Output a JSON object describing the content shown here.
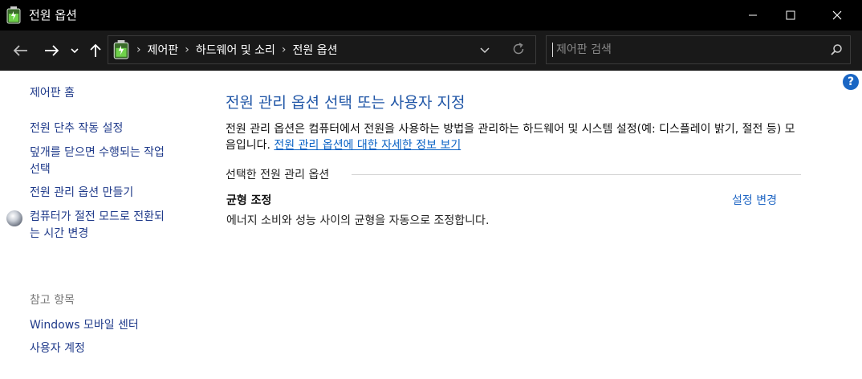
{
  "window": {
    "title": "전원 옵션"
  },
  "address": {
    "crumbs": [
      "제어판",
      "하드웨어 및 소리",
      "전원 옵션"
    ]
  },
  "search": {
    "placeholder": "제어판 검색"
  },
  "sidebar": {
    "home": "제어판 홈",
    "tasks": [
      "전원 단추 작동 설정",
      "덮개를 닫으면 수행되는 작업",
      "선택",
      "전원 관리 옵션 만들기",
      "컴퓨터가 절전 모드로 전환되",
      "는 시간 변경"
    ],
    "see_also_heading": "참고 항목",
    "see_also": [
      "Windows 모바일 센터",
      "사용자 계정"
    ]
  },
  "main": {
    "heading": "전원 관리 옵션 선택 또는 사용자 지정",
    "description": "전원 관리 옵션은 컴퓨터에서 전원을 사용하는 방법을 관리하는 하드웨어 및 시스템 설정(예: 디스플레이 밝기, 절전 등) 모음입니다. ",
    "description_link": "전원 관리 옵션에 대한 자세한 정보 보기",
    "section_title": "선택한 전원 관리 옵션",
    "plan": {
      "name": "균형 조정",
      "description": "에너지 소비와 성능 사이의 균형을 자동으로 조정합니다.",
      "change_link": "설정 변경"
    }
  },
  "icons": {
    "app": "battery-icon",
    "sleep": "moon-icon",
    "help": "help-icon"
  },
  "colors": {
    "titlebar": "#000000",
    "navbar": "#191919",
    "heading": "#1f55a6",
    "link": "#0b63c5"
  }
}
